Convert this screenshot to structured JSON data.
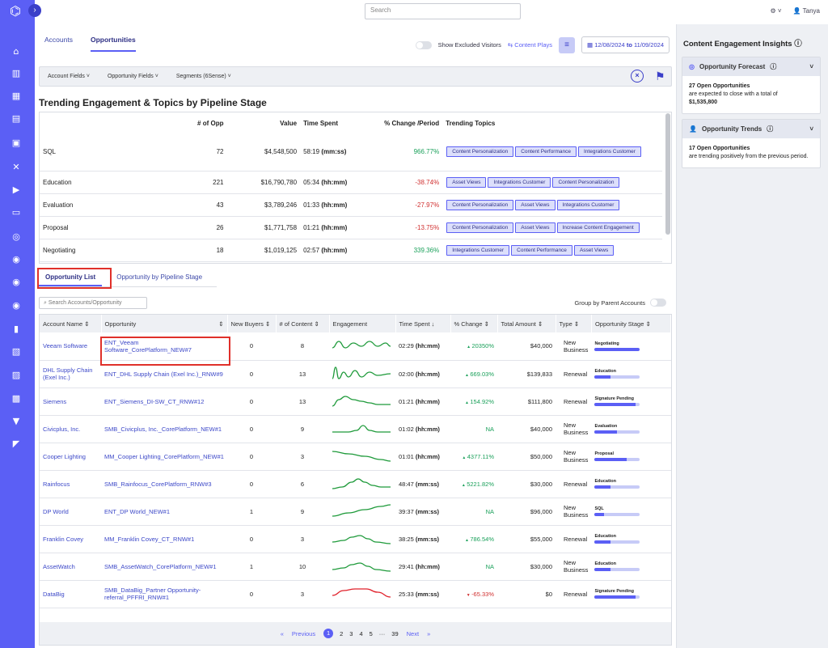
{
  "topbar": {
    "search_placeholder": "Search",
    "user_name": "Tanya"
  },
  "tabs": [
    "Accounts",
    "Opportunities"
  ],
  "toolbar": {
    "show_excluded_label": "Show Excluded Visitors",
    "content_plays_label": "Content Plays",
    "date_from": "12/08/2024",
    "date_to_word": "to",
    "date_to": "11/09/2024"
  },
  "field_filters": [
    "Account Fields",
    "Opportunity Fields",
    "Segments (6Sense)"
  ],
  "trend": {
    "title": "Trending Engagement & Topics by Pipeline Stage",
    "headers": [
      "",
      "# of Opp",
      "Value",
      "Time Spent",
      "% Change /Period",
      "Trending Topics"
    ],
    "rows": [
      {
        "stage": "SQL",
        "opp": "72",
        "value": "$4,548,500",
        "time": "58:19",
        "unit": "(mm:ss)",
        "change": "966.77%",
        "dir": "pos",
        "topics": [
          "Content Personalization",
          "Content Performance",
          "Integrations Customer"
        ]
      },
      {
        "stage": "Education",
        "opp": "221",
        "value": "$16,790,780",
        "time": "05:34",
        "unit": "(hh:mm)",
        "change": "-38.74%",
        "dir": "neg",
        "topics": [
          "Asset Views",
          "Integrations Customer",
          "Content Personalization"
        ]
      },
      {
        "stage": "Evaluation",
        "opp": "43",
        "value": "$3,789,246",
        "time": "01:33",
        "unit": "(hh:mm)",
        "change": "-27.97%",
        "dir": "neg",
        "topics": [
          "Content Personalization",
          "Asset Views",
          "Integrations Customer"
        ]
      },
      {
        "stage": "Proposal",
        "opp": "26",
        "value": "$1,771,758",
        "time": "01:21",
        "unit": "(hh:mm)",
        "change": "-13.75%",
        "dir": "neg",
        "topics": [
          "Content Personalization",
          "Asset Views",
          "Increase Content Engagement"
        ]
      },
      {
        "stage": "Negotiating",
        "opp": "18",
        "value": "$1,019,125",
        "time": "02:57",
        "unit": "(hh:mm)",
        "change": "339.36%",
        "dir": "pos",
        "topics": [
          "Integrations Customer",
          "Content Performance",
          "Asset Views"
        ]
      }
    ]
  },
  "subtabs": [
    "Opportunity List",
    "Opportunity by Pipeline Stage"
  ],
  "list": {
    "search_placeholder": "Search Accounts/Opportunity",
    "group_label": "Group by Parent Accounts",
    "headers": [
      "Account Name",
      "Opportunity",
      "New Buyers",
      "# of Content",
      "Engagement",
      "Time Spent",
      "% Change",
      "Total Amount",
      "Type",
      "Opportunity Stage"
    ],
    "rows": [
      {
        "account": "Veeam Software",
        "opp": "ENT_Veeam Software_CorePlatform_NEW#7",
        "buyers": "0",
        "content": "8",
        "time": "02:29",
        "unit": "(hh:mm)",
        "change": "20350%",
        "dir": "up",
        "amount": "$40,000",
        "type": "New Business",
        "stage": "Negotiating",
        "stage_progress": 1.0,
        "spark": "wave",
        "color": "#1e9a3a"
      },
      {
        "account": "DHL Supply Chain (Exel Inc.)",
        "opp": "ENT_DHL Supply Chain (Exel Inc.)_RNW#9",
        "buyers": "0",
        "content": "13",
        "time": "02:00",
        "unit": "(hh:mm)",
        "change": "669.03%",
        "dir": "up",
        "amount": "$139,833",
        "type": "Renewal",
        "stage": "Education",
        "stage_progress": 0.35,
        "spark": "spiky",
        "color": "#1e9a3a"
      },
      {
        "account": "Siemens",
        "opp": "ENT_Siemens_DI-SW_CT_RNW#12",
        "buyers": "0",
        "content": "13",
        "time": "01:21",
        "unit": "(hh:mm)",
        "change": "154.92%",
        "dir": "up",
        "amount": "$111,800",
        "type": "Renewal",
        "stage": "Signature Pending",
        "stage_progress": 0.9,
        "spark": "hump",
        "color": "#1e9a3a"
      },
      {
        "account": "Civicplus, Inc.",
        "opp": "SMB_Civicplus, Inc._CorePlatform_NEW#1",
        "buyers": "0",
        "content": "9",
        "time": "01:02",
        "unit": "(hh:mm)",
        "change": "NA",
        "dir": "na",
        "amount": "$40,000",
        "type": "New Business",
        "stage": "Evaluation",
        "stage_progress": 0.5,
        "spark": "bump",
        "color": "#1e9a3a"
      },
      {
        "account": "Cooper Lighting",
        "opp": "MM_Cooper Lighting_CorePlatform_NEW#1",
        "buyers": "0",
        "content": "3",
        "time": "01:01",
        "unit": "(hh:mm)",
        "change": "4377.11%",
        "dir": "up",
        "amount": "$50,000",
        "type": "New Business",
        "stage": "Proposal",
        "stage_progress": 0.7,
        "spark": "decline",
        "color": "#1e9a3a"
      },
      {
        "account": "Rainfocus",
        "opp": "SMB_Rainfocus_CorePlatform_RNW#3",
        "buyers": "0",
        "content": "6",
        "time": "48:47",
        "unit": "(mm:ss)",
        "change": "5221.82%",
        "dir": "up",
        "amount": "$30,000",
        "type": "Renewal",
        "stage": "Education",
        "stage_progress": 0.35,
        "spark": "peak",
        "color": "#1e9a3a"
      },
      {
        "account": "DP World",
        "opp": "ENT_DP World_NEW#1",
        "buyers": "1",
        "content": "9",
        "time": "39:37",
        "unit": "(mm:ss)",
        "change": "NA",
        "dir": "na",
        "amount": "$96,000",
        "type": "New Business",
        "stage": "SQL",
        "stage_progress": 0.2,
        "spark": "rise",
        "color": "#1e9a3a"
      },
      {
        "account": "Franklin Covey",
        "opp": "MM_Franklin Covey_CT_RNW#1",
        "buyers": "0",
        "content": "3",
        "time": "38:25",
        "unit": "(mm:ss)",
        "change": "786.54%",
        "dir": "up",
        "amount": "$55,000",
        "type": "Renewal",
        "stage": "Education",
        "stage_progress": 0.35,
        "spark": "hill",
        "color": "#1e9a3a"
      },
      {
        "account": "AssetWatch",
        "opp": "SMB_AssetWatch_CorePlatform_NEW#1",
        "buyers": "1",
        "content": "10",
        "time": "29:41",
        "unit": "(hh:mm)",
        "change": "NA",
        "dir": "na",
        "amount": "$30,000",
        "type": "New Business",
        "stage": "Education",
        "stage_progress": 0.35,
        "spark": "hill",
        "color": "#1e9a3a"
      },
      {
        "account": "DataBig",
        "opp": "SMB_DataBig_Partner Opportunity-referral_PFFRI_RNW#1",
        "buyers": "0",
        "content": "3",
        "time": "25:33",
        "unit": "(mm:ss)",
        "change": "-65.33%",
        "dir": "down",
        "amount": "$0",
        "type": "Renewal",
        "stage": "Signature Pending",
        "stage_progress": 0.9,
        "spark": "arch",
        "color": "#e0202a"
      }
    ]
  },
  "pager": {
    "previous": "Previous",
    "next": "Next",
    "pages": [
      "1",
      "2",
      "3",
      "4",
      "5",
      "···",
      "39"
    ]
  },
  "insights": {
    "title": "Content Engagement Insights",
    "forecast": {
      "title": "Opportunity Forecast",
      "line1": "27 Open Opportunities",
      "line2": "are expected to close with a total of",
      "line3": "$1,535,800"
    },
    "trends": {
      "title": "Opportunity Trends",
      "line1": "17 Open Opportunities",
      "line2": "are trending positively from the previous period."
    }
  },
  "colors": {
    "accent": "#5b5ff5",
    "positive": "#1aa05a",
    "negative": "#d03030",
    "highlight": "#e0302a"
  }
}
